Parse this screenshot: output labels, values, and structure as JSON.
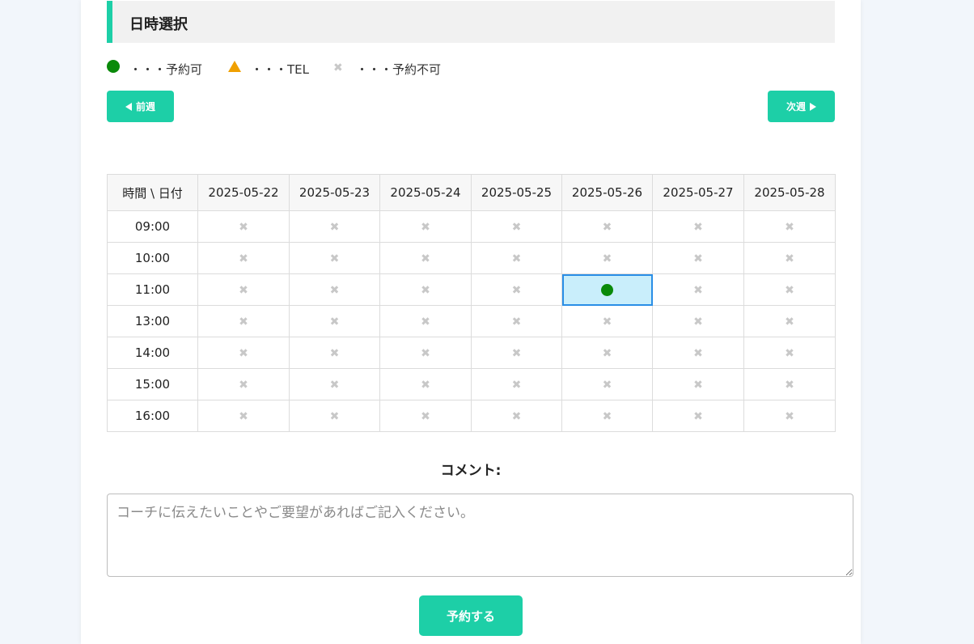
{
  "section": {
    "title": "日時選択"
  },
  "legend": [
    {
      "icon": "filled-circle-icon",
      "color": "#0a8a0a",
      "label": "・・・予約可"
    },
    {
      "icon": "triangle-icon",
      "color": "#f0a000",
      "label": "・・・TEL"
    },
    {
      "icon": "x-mark-icon",
      "color": "#c8c8c8",
      "label": "・・・予約不可"
    }
  ],
  "nav": {
    "prev_label": "前週",
    "next_label": "次週"
  },
  "schedule": {
    "corner_header": "時間 \\ 日付",
    "dates": [
      "2025-05-22",
      "2025-05-23",
      "2025-05-24",
      "2025-05-25",
      "2025-05-26",
      "2025-05-27",
      "2025-05-28"
    ],
    "times": [
      "09:00",
      "10:00",
      "11:00",
      "13:00",
      "14:00",
      "15:00",
      "16:00"
    ],
    "status": [
      [
        "x",
        "x",
        "x",
        "x",
        "x",
        "x",
        "x"
      ],
      [
        "x",
        "x",
        "x",
        "x",
        "x",
        "x",
        "x"
      ],
      [
        "x",
        "x",
        "x",
        "x",
        "o",
        "x",
        "x"
      ],
      [
        "x",
        "x",
        "x",
        "x",
        "x",
        "x",
        "x"
      ],
      [
        "x",
        "x",
        "x",
        "x",
        "x",
        "x",
        "x"
      ],
      [
        "x",
        "x",
        "x",
        "x",
        "x",
        "x",
        "x"
      ],
      [
        "x",
        "x",
        "x",
        "x",
        "x",
        "x",
        "x"
      ]
    ],
    "selected": {
      "time": "11:00",
      "date": "2025-05-26"
    },
    "x_glyph": "✖"
  },
  "comment": {
    "label": "コメント:",
    "placeholder": "コーチに伝えたいことやご要望があればご記入ください。",
    "value": ""
  },
  "submit_label": "予約する",
  "colors": {
    "accent": "#1dcfa7",
    "available": "#0a8a0a",
    "tel": "#f0a000",
    "unavailable": "#c8c8c8",
    "selected_bg": "#c9eefb",
    "selected_border": "#2a8ee6"
  }
}
